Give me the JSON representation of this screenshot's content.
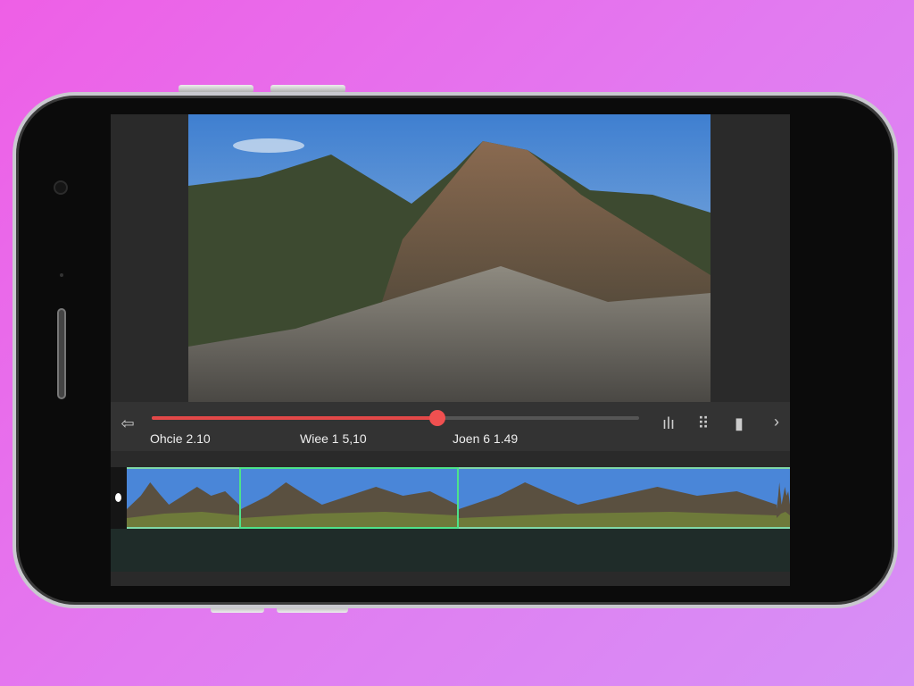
{
  "player": {
    "progress_fraction": 0.586,
    "times": [
      "Ohcie 2.10",
      "Wiee 1 5,10",
      "Joen 6 1.49"
    ],
    "icons": [
      "back-icon",
      "audio-waveform-icon",
      "grid-icon",
      "bookmark-icon",
      "chevron-right-icon"
    ]
  },
  "colors": {
    "accent": "#e34848",
    "selection": "#4ee28a"
  },
  "timeline": {
    "frames": 4,
    "selected_index": 1
  }
}
